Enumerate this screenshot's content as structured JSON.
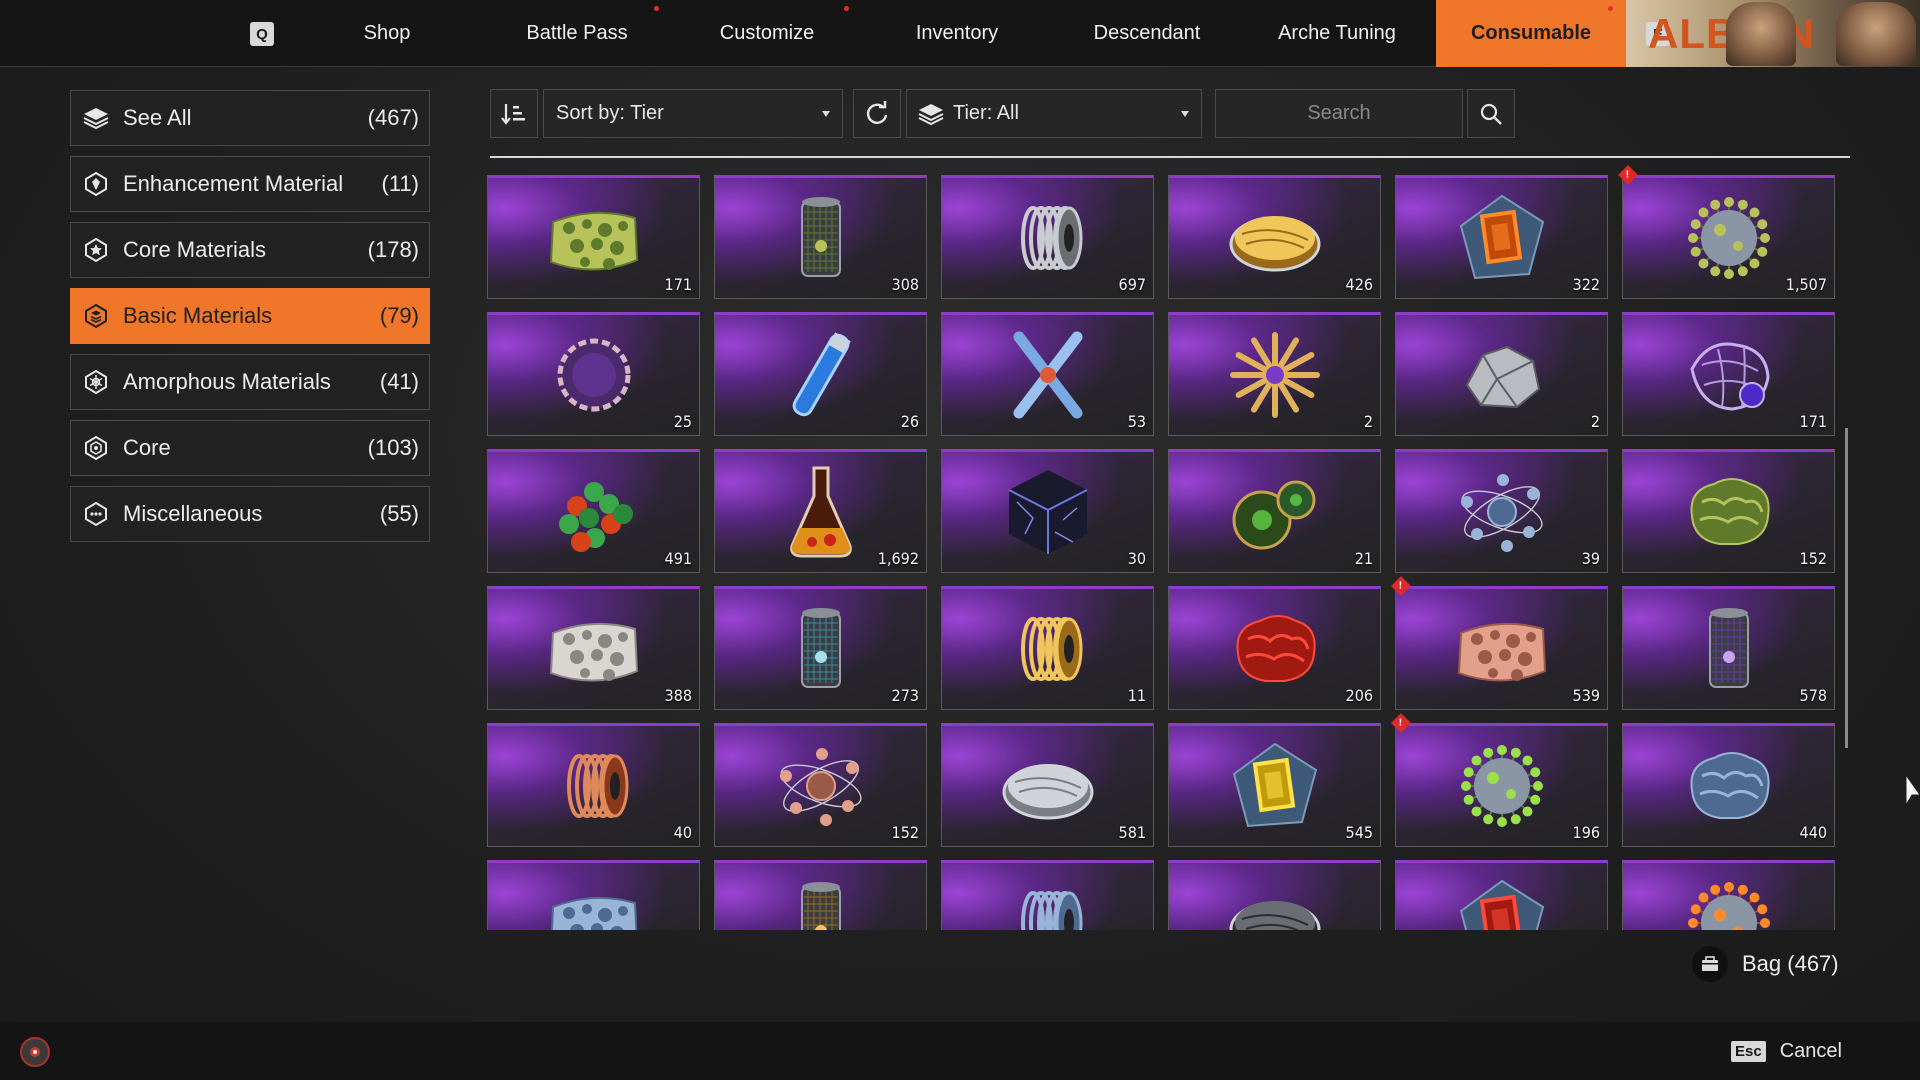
{
  "nav": {
    "left_key": "Q",
    "right_key": "E",
    "tabs": [
      {
        "label": "Shop",
        "dot": false,
        "active": false
      },
      {
        "label": "Battle Pass",
        "dot": true,
        "active": false
      },
      {
        "label": "Customize",
        "dot": true,
        "active": false
      },
      {
        "label": "Inventory",
        "dot": false,
        "active": false
      },
      {
        "label": "Descendant",
        "dot": false,
        "active": false
      },
      {
        "label": "Arche Tuning",
        "dot": false,
        "active": false
      },
      {
        "label": "Consumable",
        "dot": true,
        "active": true
      }
    ],
    "banner_text": "ALBION"
  },
  "sidebar": {
    "categories": [
      {
        "label": "See All",
        "count": "(467)",
        "icon": "layers-icon",
        "active": false
      },
      {
        "label": "Enhancement Material",
        "count": "(11)",
        "icon": "hexagon-gem-icon",
        "active": false
      },
      {
        "label": "Core Materials",
        "count": "(178)",
        "icon": "star-badge-icon",
        "active": false
      },
      {
        "label": "Basic Materials",
        "count": "(79)",
        "icon": "stack-hexagon-icon",
        "active": true
      },
      {
        "label": "Amorphous Materials",
        "count": "(41)",
        "icon": "web-hexagon-icon",
        "active": false
      },
      {
        "label": "Core",
        "count": "(103)",
        "icon": "concentric-hexagon-icon",
        "active": false
      },
      {
        "label": "Miscellaneous",
        "count": "(55)",
        "icon": "dots-hexagon-icon",
        "active": false
      }
    ]
  },
  "toolbar": {
    "sort_label": "Sort by: Tier",
    "tier_label": "Tier: All",
    "search_placeholder": "Search"
  },
  "grid": {
    "items": [
      {
        "icon": "green-sponge-icon",
        "count": "171",
        "new": false
      },
      {
        "icon": "green-cylinder-icon",
        "count": "308",
        "new": false
      },
      {
        "icon": "metal-coil-icon",
        "count": "697",
        "new": false
      },
      {
        "icon": "gold-petri-dish-icon",
        "count": "426",
        "new": false
      },
      {
        "icon": "orange-chip-icon",
        "count": "322",
        "new": false
      },
      {
        "icon": "green-virus-icon",
        "count": "1,507",
        "new": true
      },
      {
        "icon": "chain-ring-icon",
        "count": "25",
        "new": false
      },
      {
        "icon": "blue-vial-icon",
        "count": "26",
        "new": false
      },
      {
        "icon": "chromosome-icon",
        "count": "53",
        "new": false
      },
      {
        "icon": "gold-crystal-cluster-icon",
        "count": "2",
        "new": false
      },
      {
        "icon": "silver-ore-icon",
        "count": "2",
        "new": false
      },
      {
        "icon": "purple-mesh-icon",
        "count": "171",
        "new": false
      },
      {
        "icon": "molecule-cluster-icon",
        "count": "491",
        "new": false
      },
      {
        "icon": "flask-icon",
        "count": "1,692",
        "new": false
      },
      {
        "icon": "dark-cube-icon",
        "count": "30",
        "new": false
      },
      {
        "icon": "green-orbs-icon",
        "count": "21",
        "new": false
      },
      {
        "icon": "blue-atom-icon",
        "count": "39",
        "new": false
      },
      {
        "icon": "green-brain-icon",
        "count": "152",
        "new": false
      },
      {
        "icon": "white-sponge-icon",
        "count": "388",
        "new": false
      },
      {
        "icon": "cyan-cylinder-icon",
        "count": "273",
        "new": false
      },
      {
        "icon": "gold-coil-icon",
        "count": "11",
        "new": false
      },
      {
        "icon": "red-brain-icon",
        "count": "206",
        "new": false
      },
      {
        "icon": "pink-sponge-icon",
        "count": "539",
        "new": true
      },
      {
        "icon": "purple-cylinder-icon",
        "count": "578",
        "new": false
      },
      {
        "icon": "copper-coil-icon",
        "count": "40",
        "new": false
      },
      {
        "icon": "pink-atom-icon",
        "count": "152",
        "new": false
      },
      {
        "icon": "silver-petri-dish-icon",
        "count": "581",
        "new": false
      },
      {
        "icon": "yellow-chip-icon",
        "count": "545",
        "new": false
      },
      {
        "icon": "lime-virus-icon",
        "count": "196",
        "new": true
      },
      {
        "icon": "blue-brain-icon",
        "count": "440",
        "new": false
      },
      {
        "icon": "blue-sponge-icon",
        "count": "",
        "new": false
      },
      {
        "icon": "gold-cylinder-icon",
        "count": "",
        "new": false
      },
      {
        "icon": "blue-coil-icon",
        "count": "",
        "new": false
      },
      {
        "icon": "dark-petri-dish-icon",
        "count": "",
        "new": false
      },
      {
        "icon": "red-chip-icon",
        "count": "",
        "new": false
      },
      {
        "icon": "orange-virus-icon",
        "count": "",
        "new": false
      }
    ]
  },
  "footer": {
    "bag_label": "Bag (467)",
    "esc_key": "Esc",
    "cancel_label": "Cancel"
  },
  "colors": {
    "accent": "#f0762a",
    "tile_purple": "#8d3ec8",
    "new_badge": "#e02a2a"
  }
}
